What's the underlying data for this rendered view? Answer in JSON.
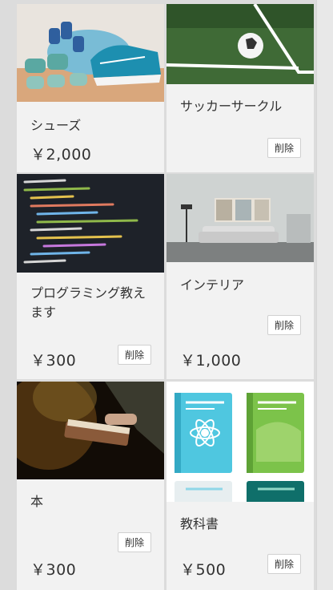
{
  "colors": {
    "card_bg": "#f2f2f2",
    "page_bg": "#dcdcdc",
    "button_bg": "#ffffff"
  },
  "items": [
    {
      "title": "シューズ",
      "price": "￥2,000",
      "image": "fitness-shoes-dumbbells-photo"
    },
    {
      "title": "サッカーサークル",
      "delete_label": "削除",
      "image": "soccer-ball-field-photo"
    },
    {
      "title": "プログラミング教えます",
      "price": "￥300",
      "delete_label": "削除",
      "image": "code-screen-photo"
    },
    {
      "title": "インテリア",
      "price": "￥1,000",
      "delete_label": "削除",
      "image": "living-room-interior-photo"
    },
    {
      "title": "本",
      "price": "￥300",
      "delete_label": "削除",
      "image": "reading-book-photo"
    },
    {
      "title": "教科書",
      "price": "￥500",
      "delete_label": "削除",
      "image": "textbooks-illustration"
    }
  ]
}
